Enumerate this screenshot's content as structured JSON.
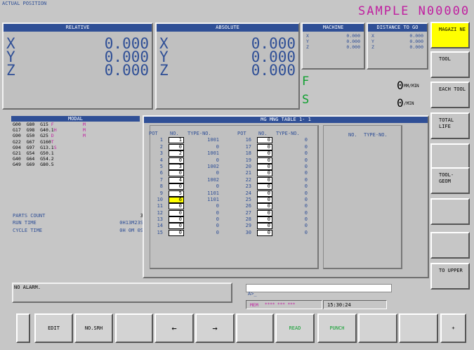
{
  "header": {
    "title": "ACTUAL POSITION",
    "program": "SAMPLE N00000"
  },
  "relative": {
    "title": "RELATIVE",
    "axes": [
      {
        "axis": "X",
        "value": "0.000"
      },
      {
        "axis": "Y",
        "value": "0.000"
      },
      {
        "axis": "Z",
        "value": "0.000"
      }
    ]
  },
  "absolute": {
    "title": "ABSOLUTE",
    "axes": [
      {
        "axis": "X",
        "value": "0.000"
      },
      {
        "axis": "Y",
        "value": "0.000"
      },
      {
        "axis": "Z",
        "value": "0.000"
      }
    ]
  },
  "machine": {
    "title": "MACHINE",
    "axes": [
      {
        "axis": "X",
        "value": "0.000"
      },
      {
        "axis": "Y",
        "value": "0.000"
      },
      {
        "axis": "Z",
        "value": "0.000"
      }
    ]
  },
  "distance": {
    "title": "DISTANCE TO GO",
    "axes": [
      {
        "axis": "X",
        "value": "0.000"
      },
      {
        "axis": "Y",
        "value": "0.000"
      },
      {
        "axis": "Z",
        "value": "0.000"
      }
    ]
  },
  "feed": {
    "f_label": "F",
    "f_value": "0",
    "f_unit": "MM/MIN",
    "s_label": "S",
    "s_value": "0",
    "s_unit": "/MIN"
  },
  "modal": {
    "title": "MODAL",
    "rows": [
      {
        "text": "G00  G80  G15 ",
        "code": "F",
        "right": "M"
      },
      {
        "text": "G17  G98  G40.1",
        "code": "H",
        "right": "M"
      },
      {
        "text": "G90  G50  G25 ",
        "code": "D",
        "right": "M"
      },
      {
        "text": "G22  G67  G160",
        "code": "T",
        "right": ""
      },
      {
        "text": "G94  G97  G13.1",
        "code": "S",
        "right": ""
      },
      {
        "text": "G21  G54  G50.1",
        "code": "",
        "right": ""
      },
      {
        "text": "G40  G64  G54.2",
        "code": "",
        "right": ""
      },
      {
        "text": "G49  G69  G80.5",
        "code": "",
        "right": ""
      }
    ]
  },
  "counters": {
    "parts_label": "PARTS COUNT",
    "parts_value": "3",
    "run_label": "RUN TIME",
    "run_value": "0H13M23S",
    "cycle_label": "CYCLE TIME",
    "cycle_value": "0H 0M 0S"
  },
  "mg_table": {
    "title": "MG MNG TABLE 1-  1",
    "headers": {
      "pot": "POT",
      "no": "NO.",
      "type": "TYPE-NO."
    },
    "left": [
      {
        "pot": "1",
        "no": "1",
        "type": "1001"
      },
      {
        "pot": "2",
        "no": "0",
        "type": "0"
      },
      {
        "pot": "3",
        "no": "2",
        "type": "1001"
      },
      {
        "pot": "4",
        "no": "0",
        "type": "0"
      },
      {
        "pot": "5",
        "no": "3",
        "type": "1002"
      },
      {
        "pot": "6",
        "no": "0",
        "type": "0"
      },
      {
        "pot": "7",
        "no": "4",
        "type": "1002"
      },
      {
        "pot": "8",
        "no": "0",
        "type": "0"
      },
      {
        "pot": "9",
        "no": "5",
        "type": "1101"
      },
      {
        "pot": "10",
        "no": "6",
        "type": "1101"
      },
      {
        "pot": "11",
        "no": "0",
        "type": "0"
      },
      {
        "pot": "12",
        "no": "0",
        "type": "0"
      },
      {
        "pot": "13",
        "no": "0",
        "type": "0"
      },
      {
        "pot": "14",
        "no": "0",
        "type": "0"
      },
      {
        "pot": "15",
        "no": "0",
        "type": "0"
      }
    ],
    "right": [
      {
        "pot": "16",
        "no": "0",
        "type": "0"
      },
      {
        "pot": "17",
        "no": "0",
        "type": "0"
      },
      {
        "pot": "18",
        "no": "0",
        "type": "0"
      },
      {
        "pot": "19",
        "no": "0",
        "type": "0"
      },
      {
        "pot": "20",
        "no": "0",
        "type": "0"
      },
      {
        "pot": "21",
        "no": "0",
        "type": "0"
      },
      {
        "pot": "22",
        "no": "0",
        "type": "0"
      },
      {
        "pot": "23",
        "no": "0",
        "type": "0"
      },
      {
        "pot": "24",
        "no": "0",
        "type": "0"
      },
      {
        "pot": "25",
        "no": "0",
        "type": "0"
      },
      {
        "pot": "26",
        "no": "0",
        "type": "0"
      },
      {
        "pot": "27",
        "no": "0",
        "type": "0"
      },
      {
        "pot": "28",
        "no": "0",
        "type": "0"
      },
      {
        "pot": "29",
        "no": "0",
        "type": "0"
      },
      {
        "pot": "30",
        "no": "0",
        "type": "0"
      }
    ],
    "spindle_headers": {
      "no": "NO.",
      "type": "TYPE-NO."
    }
  },
  "status": {
    "alarm": "NO ALARM.",
    "input_prompt": "A>_",
    "mode": "MEM",
    "mode_rest": "**** *** ***",
    "time": "15:30:24"
  },
  "right_softkeys": [
    "MAGAZI NE",
    "TOOL",
    "EACH TOOL",
    "TOTAL LIFE",
    "",
    "TOOL- GEOM",
    "",
    "",
    "TO UPPER"
  ],
  "bottom_softkeys": [
    "",
    "EDIT",
    "NO.SRH",
    "",
    "←",
    "→",
    "",
    "READ",
    "PUNCH",
    "",
    "",
    "+"
  ],
  "colors": {
    "accent_blue": "#2f4f96",
    "highlight_yellow": "#ffff00",
    "magenta": "#c020a0",
    "green": "#10a030"
  }
}
